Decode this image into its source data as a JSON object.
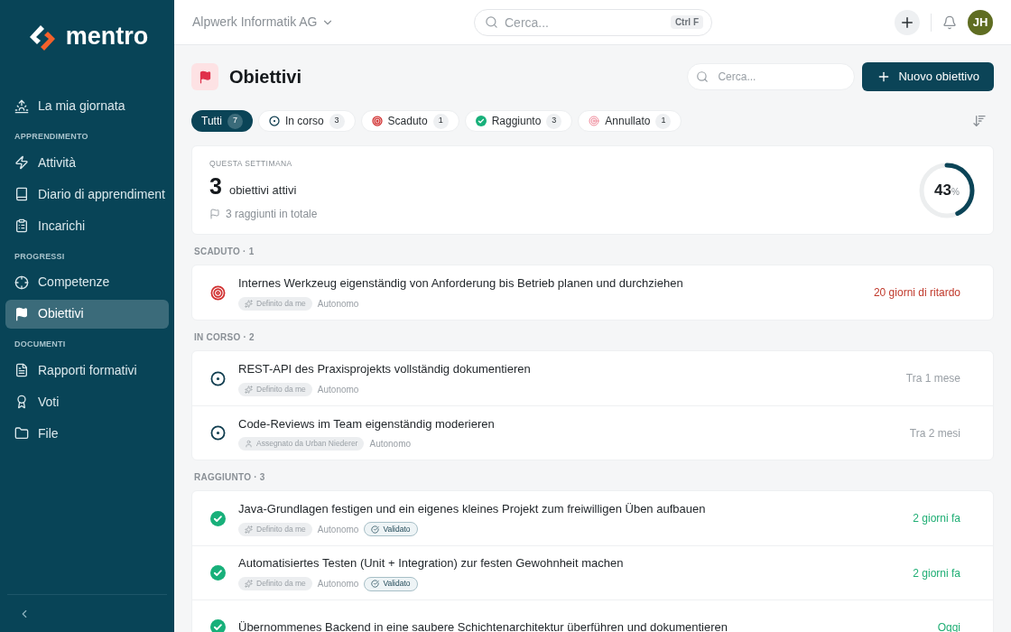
{
  "sidebar": {
    "logo": "mentro",
    "groups": [
      {
        "items": [
          {
            "label": "La mia giornata",
            "kind": "sunrise",
            "selected": false
          }
        ]
      },
      {
        "heading": "APPRENDIMENTO",
        "items": [
          {
            "label": "Attività",
            "kind": "zap",
            "selected": false
          },
          {
            "label": "Diario di apprendiment",
            "kind": "book",
            "selected": false
          },
          {
            "label": "Incarichi",
            "kind": "clipboard",
            "selected": false
          }
        ]
      },
      {
        "heading": "PROGRESSI",
        "items": [
          {
            "label": "Competenze",
            "kind": "crosshair",
            "selected": false
          },
          {
            "label": "Obiettivi",
            "kind": "flag",
            "selected": true
          }
        ]
      },
      {
        "heading": "DOCUMENTI",
        "items": [
          {
            "label": "Rapporti formativi",
            "kind": "file",
            "selected": false
          },
          {
            "label": "Voti",
            "kind": "award",
            "selected": false
          },
          {
            "label": "File",
            "kind": "folder",
            "selected": false
          }
        ]
      }
    ]
  },
  "topbar": {
    "organization": "Alpwerk Informatik AG",
    "search": {
      "placeholder": "Cerca...",
      "shortcut": "Ctrl F"
    },
    "avatar": "JH"
  },
  "page": {
    "title": "Obiettivi",
    "search": {
      "placeholder": "Cerca..."
    },
    "new_button": "Nuovo obiettivo"
  },
  "filters": [
    {
      "label": "Tutti",
      "count": "7",
      "kind": "all",
      "selected": true
    },
    {
      "label": "In corso",
      "count": "3",
      "kind": "in_progress",
      "selected": false
    },
    {
      "label": "Scaduto",
      "count": "1",
      "kind": "overdue",
      "selected": false
    },
    {
      "label": "Raggiunto",
      "count": "3",
      "kind": "done",
      "selected": false
    },
    {
      "label": "Annullato",
      "count": "1",
      "kind": "cancelled",
      "selected": false
    }
  ],
  "summary": {
    "eyebrow": "QUESTA SETTIMANA",
    "count": "3",
    "count_label": "obiettivi attivi",
    "total": "3 raggiunti in totale",
    "percent": "43",
    "unit": "%",
    "level": 0.43
  },
  "sections": [
    {
      "heading": "SCADUTO · 1",
      "kind": "overdue",
      "goals": [
        {
          "title": "Internes Werkzeug eigenständig von Anforderung bis Betrieb planen und durchziehen",
          "source": "Definito da me",
          "kind": "self",
          "mode": "Autonomo",
          "when": "20 giorni di ritardo"
        }
      ]
    },
    {
      "heading": "IN CORSO · 2",
      "kind": "in_progress",
      "goals": [
        {
          "title": "REST-API des Praxisprojekts vollständig dokumentieren",
          "source": "Definito da me",
          "kind": "self",
          "mode": "Autonomo",
          "when": "Tra 1 mese"
        },
        {
          "title": "Code-Reviews im Team eigenständig moderieren",
          "source": "Assegnato da Urban Niederer",
          "kind": "assigned",
          "mode": "Autonomo",
          "when": "Tra 2 mesi"
        }
      ]
    },
    {
      "heading": "RAGGIUNTO · 3",
      "kind": "done",
      "goals": [
        {
          "title": "Java-Grundlagen festigen und ein eigenes kleines Projekt zum freiwilligen Üben aufbauen",
          "source": "Definito da me",
          "kind": "self",
          "mode": "Autonomo",
          "validated": "Validato",
          "when": "2 giorni fa"
        },
        {
          "title": "Automatisiertes Testen (Unit + Integration) zur festen Gewohnheit machen",
          "source": "Definito da me",
          "kind": "self",
          "mode": "Autonomo",
          "validated": "Validato",
          "when": "2 giorni fa"
        },
        {
          "title": "Übernommenes Backend in eine saubere Schichtenarchitektur überführen und dokumentieren",
          "when": "Oggi"
        }
      ]
    }
  ]
}
